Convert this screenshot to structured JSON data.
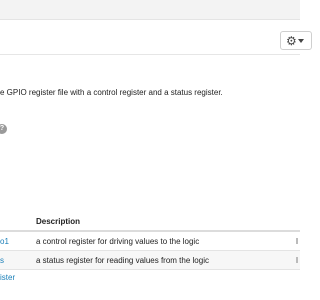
{
  "header": {
    "settings_icon": "gear-icon"
  },
  "module": {
    "description": "e GPIO register file with a control register and a status register."
  },
  "table": {
    "columns": [
      "",
      "Description"
    ],
    "rows": [
      {
        "name": "o1",
        "description": "a control register for driving values to the logic"
      },
      {
        "name": "s",
        "description": "a status register for reading values from the logic"
      }
    ]
  },
  "footer": {
    "link_text": "ister"
  },
  "colors": {
    "link": "#1a7fb8",
    "topbar": "#f3f3f3"
  }
}
